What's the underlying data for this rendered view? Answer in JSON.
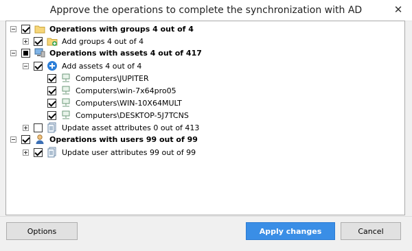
{
  "window": {
    "title": "Approve the operations to complete the synchronization with AD"
  },
  "tree": {
    "groups": {
      "label": "Operations with groups 4 out of 4",
      "child": "Add groups 4 out of 4"
    },
    "assets": {
      "label": "Operations with assets 4 out of 417",
      "add": "Add assets 4 out of 4",
      "computers": [
        "Computers\\JUPITER",
        "Computers\\win-7x64pro05",
        "Computers\\WIN-10X64MULT",
        "Computers\\DESKTOP-5J7TCNS"
      ],
      "update": "Update asset attributes 0 out of 413"
    },
    "users": {
      "label": "Operations with users 99 out of 99",
      "update": "Update user attributes 99 out of 99"
    }
  },
  "buttons": {
    "options": "Options",
    "apply": "Apply changes",
    "cancel": "Cancel"
  }
}
